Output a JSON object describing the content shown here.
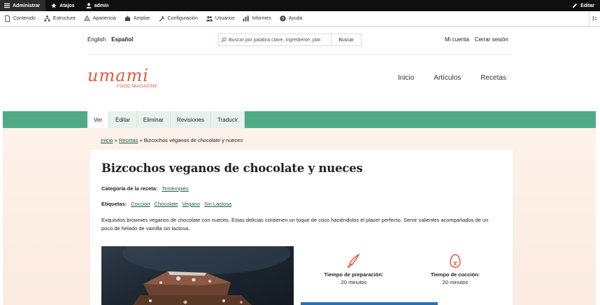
{
  "admin_bar": {
    "manage": "Administrar",
    "shortcuts": "Atajos",
    "user": "admin",
    "edit": "Editar"
  },
  "admin_tray": {
    "items": [
      "Contenido",
      "Estructura",
      "Apariencia",
      "Ampliar",
      "Configuración",
      "Usuarios",
      "Informes",
      "Ayuda"
    ]
  },
  "header": {
    "languages": [
      "English",
      "Español"
    ],
    "active_language": "Español",
    "search_placeholder": "Buscar por palabra clave, ingrediente, plat",
    "search_button": "Buscar",
    "account": "Mi cuenta",
    "logout": "Cerrar sesión"
  },
  "logo": {
    "name": "umami",
    "tagline": "FOOD MAGAZINE"
  },
  "main_nav": [
    "Inicio",
    "Artículos",
    "Recetas"
  ],
  "tabs": [
    "Ver",
    "Editar",
    "Eliminar",
    "Revisiones",
    "Traducir"
  ],
  "active_tab": "Ver",
  "breadcrumb": {
    "home": "Inicio",
    "sep": "»",
    "recipes": "Recetas",
    "current": "Bizcochos veganos de chocolate y nueces"
  },
  "recipe": {
    "title": "Bizcochos veganos de chocolate y nueces",
    "category_label": "Categoría de la receta:",
    "category": "Tentempiés",
    "tags_label": "Etiquetas:",
    "tags": [
      "Cocción",
      "Chocolate",
      "Vegano",
      "Sin Lactosa"
    ],
    "description": "Exquisitos brownies veganos de chocolate con nueces. Estas delicias contienen un toque de coco haciéndolos el placer perfecto. Servir calientes acompañados de un poco de helado de vainilla sin lactosa.",
    "prep_label": "Tiempo de preparación:",
    "prep_value": "20 minutos",
    "cook_label": "Tiempo de cocción:",
    "cook_value": "20 minutos"
  },
  "colors": {
    "brand": "#e15a3a",
    "green": "#4fab86",
    "link": "#1d5b4b"
  }
}
